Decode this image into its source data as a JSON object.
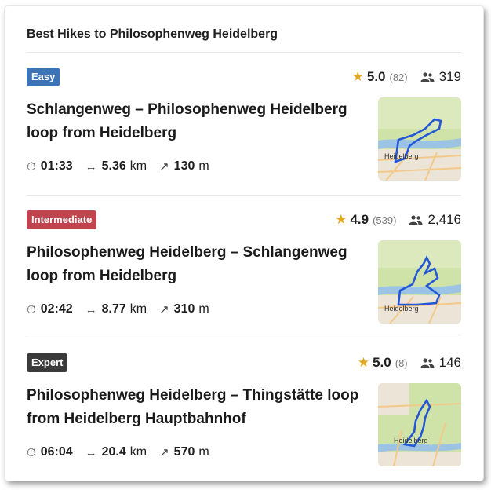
{
  "page": {
    "title": "Best Hikes to Philosophenweg Heidelberg"
  },
  "hikes": [
    {
      "difficulty": "Easy",
      "difficulty_color": "#3d74b8",
      "rating": "5.0",
      "reviews": "(82)",
      "hikers": "319",
      "name": "Schlangenweg – Philosophenweg Heidelberg loop from Heidelberg",
      "duration": "01:33",
      "distance": "5.36",
      "distance_unit": "km",
      "ascent": "130",
      "ascent_unit": "m",
      "map_label": "Heidelberg",
      "map_icon": "route-map-thumbnail"
    },
    {
      "difficulty": "Intermediate",
      "difficulty_color": "#c0444e",
      "rating": "4.9",
      "reviews": "(539)",
      "hikers": "2,416",
      "name": "Philosophenweg Heidelberg – Schlangenweg loop from Heidelberg",
      "duration": "02:42",
      "distance": "8.77",
      "distance_unit": "km",
      "ascent": "310",
      "ascent_unit": "m",
      "map_label": "Heidelberg",
      "map_icon": "route-map-thumbnail"
    },
    {
      "difficulty": "Expert",
      "difficulty_color": "#3a3a3a",
      "rating": "5.0",
      "reviews": "(8)",
      "hikers": "146",
      "name": "Philosophenweg Heidelberg – Thingstätte loop from Heidelberg Hauptbahnhof",
      "duration": "06:04",
      "distance": "20.4",
      "distance_unit": "km",
      "ascent": "570",
      "ascent_unit": "m",
      "map_label": "Heidelberg",
      "map_icon": "route-map-thumbnail"
    }
  ],
  "colors": {
    "star": "#e3a91c",
    "route": "#2457d6",
    "map_green": "#cfe2a8",
    "map_river": "#9cc3e3"
  }
}
